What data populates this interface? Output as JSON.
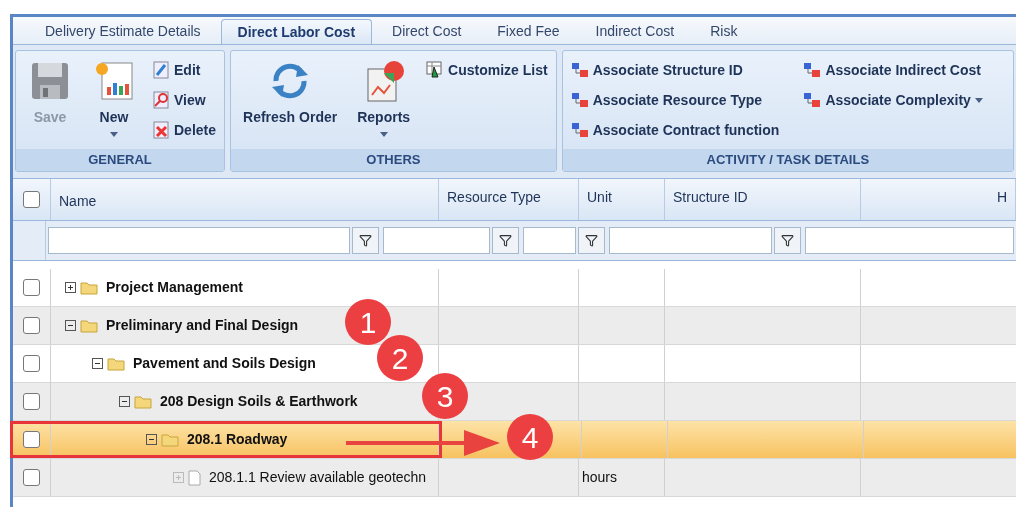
{
  "tabs": [
    {
      "label": "Delivery Estimate Details",
      "selected": false
    },
    {
      "label": "Direct Labor Cost",
      "selected": true
    },
    {
      "label": "Direct Cost",
      "selected": false
    },
    {
      "label": "Fixed Fee",
      "selected": false
    },
    {
      "label": "Indirect Cost",
      "selected": false
    },
    {
      "label": "Risk",
      "selected": false
    }
  ],
  "ribbon": {
    "groups": [
      {
        "label": "GENERAL",
        "columns": [
          [
            {
              "kind": "large",
              "label": "Save",
              "disabled": true,
              "dropdown": false
            }
          ],
          [
            {
              "kind": "large",
              "label": "New",
              "disabled": false,
              "dropdown": true
            }
          ],
          [
            {
              "kind": "small",
              "label": "Edit",
              "disabled": false,
              "dropdown": false
            },
            {
              "kind": "small",
              "label": "View",
              "disabled": false,
              "dropdown": false
            },
            {
              "kind": "small",
              "label": "Delete",
              "disabled": false,
              "dropdown": false
            }
          ]
        ]
      },
      {
        "label": "OTHERS",
        "columns": [
          [
            {
              "kind": "large",
              "label": "Refresh Order",
              "disabled": false,
              "dropdown": false
            }
          ],
          [
            {
              "kind": "large",
              "label": "Reports",
              "disabled": false,
              "dropdown": true
            }
          ],
          [
            {
              "kind": "small",
              "label": "Customize List",
              "disabled": false,
              "dropdown": false
            }
          ]
        ]
      },
      {
        "label": "ACTIVITY / TASK DETAILS",
        "columns": [
          [
            {
              "kind": "small",
              "label": "Associate Structure ID",
              "disabled": false,
              "dropdown": false
            },
            {
              "kind": "small",
              "label": "Associate Resource Type",
              "disabled": false,
              "dropdown": false
            },
            {
              "kind": "small",
              "label": "Associate Contract function",
              "disabled": false,
              "dropdown": false
            }
          ],
          [
            {
              "kind": "small",
              "label": "Associate Indirect Cost",
              "disabled": false,
              "dropdown": false
            },
            {
              "kind": "small",
              "label": "Associate Complexity",
              "disabled": false,
              "dropdown": true
            }
          ]
        ]
      }
    ]
  },
  "grid": {
    "header_checkbox": {
      "checked": false
    },
    "columns": [
      "Name",
      "Resource Type",
      "Unit",
      "Structure ID",
      "H"
    ],
    "rows": [
      {
        "name": "Project Management",
        "kind": "folder",
        "expanded": false,
        "selected": false,
        "checked": false
      },
      {
        "name": "Preliminary and Final Design",
        "kind": "folder",
        "expanded": true,
        "selected": false,
        "checked": false,
        "children": [
          {
            "name": "Pavement and Soils Design",
            "kind": "folder",
            "expanded": true,
            "selected": false,
            "checked": false,
            "children": [
              {
                "name": "208 Design Soils & Earthwork",
                "kind": "folder",
                "expanded": true,
                "selected": false,
                "checked": false,
                "children": [
                  {
                    "name": "208.1 Roadway",
                    "kind": "folder",
                    "expanded": true,
                    "selected": true,
                    "checked": false,
                    "children": [
                      {
                        "name": "208.1.1 Review available geotechn",
                        "kind": "task",
                        "expanded": false,
                        "selected": false,
                        "checked": false,
                        "unit": "hours"
                      }
                    ]
                  }
                ]
              }
            ]
          }
        ]
      }
    ]
  },
  "callouts": [
    "1",
    "2",
    "3",
    "4"
  ]
}
